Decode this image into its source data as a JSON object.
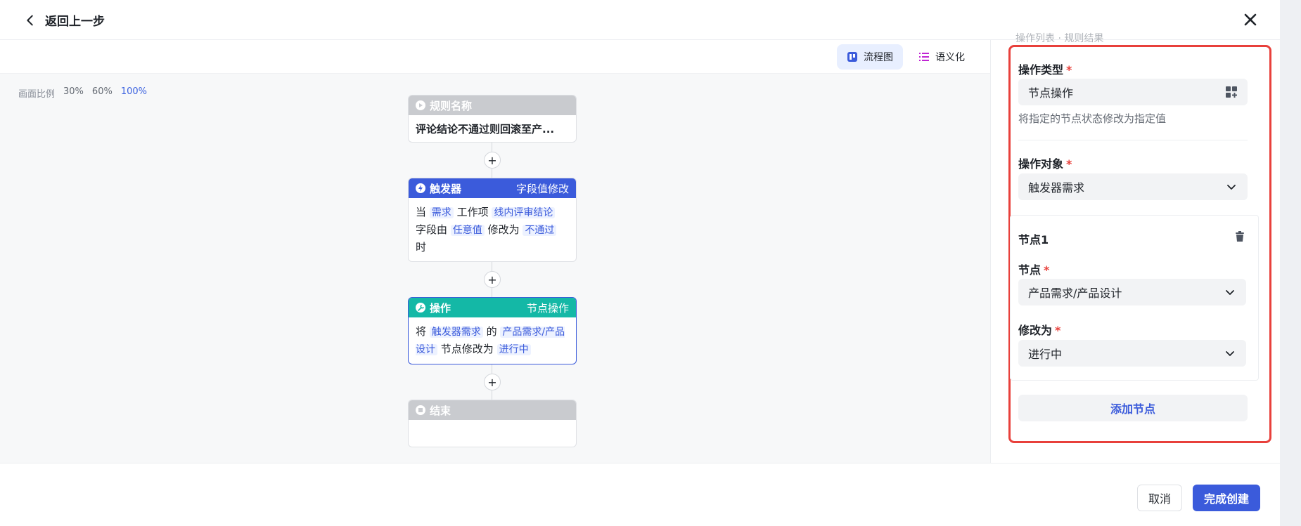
{
  "header": {
    "back_label": "返回上一步"
  },
  "canvas": {
    "view_flow_label": "流程图",
    "view_semantic_label": "语义化",
    "zoom_label": "画面比例",
    "zoom_options": [
      "30%",
      "60%",
      "100%"
    ],
    "zoom_selected": "100%"
  },
  "flow": {
    "rule_node": {
      "header": "规则名称",
      "body": "评论结论不通过则回滚至产..."
    },
    "trigger_node": {
      "header": "触发器",
      "header_right": "字段值修改",
      "t1": "当",
      "tag1": "需求",
      "t2": "工作项",
      "tag2": "线内评审结论",
      "t3": "字段由",
      "tag3": "任意值",
      "t4": "修改为",
      "tag4": "不通过",
      "t5": "时"
    },
    "action_node": {
      "header": "操作",
      "header_right": "节点操作",
      "t1": "将",
      "tag1": "触发器需求",
      "t2": "的",
      "tag2": "产品需求/产品设计",
      "t3": "节点修改为",
      "tag3": "进行中"
    },
    "end_node": {
      "header": "结束"
    },
    "plus": "+"
  },
  "panel": {
    "peek_text": "操作列表 · 规则结果",
    "op_type_label": "操作类型",
    "op_type_value": "节点操作",
    "op_type_hint": "将指定的节点状态修改为指定值",
    "op_target_label": "操作对象",
    "op_target_value": "触发器需求",
    "node_card_title": "节点1",
    "node_label": "节点",
    "node_value": "产品需求/产品设计",
    "modify_label": "修改为",
    "modify_value": "进行中",
    "add_node_label": "添加节点",
    "required_mark": "*"
  },
  "footer": {
    "cancel_label": "取消",
    "confirm_label": "完成创建"
  },
  "colors": {
    "primary": "#3b5bdb",
    "trigger": "#3b5bdb",
    "action": "#14b8a6",
    "muted_node": "#c9cbcf",
    "highlight_box": "#e8403b"
  }
}
